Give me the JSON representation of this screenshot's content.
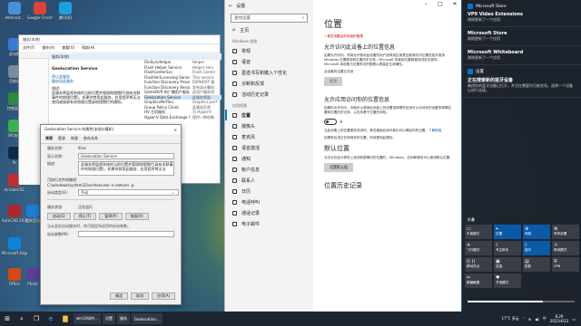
{
  "desktop": {
    "icons": [
      {
        "label": "Administ...",
        "color": "#4a90d9"
      },
      {
        "label": "Google Chrome",
        "color": "#db4437"
      },
      {
        "label": "腾讯QQ",
        "color": "#1aa1e2"
      },
      {
        "label": "此电脑",
        "color": "#3a7bd5"
      },
      {
        "label": "回收站",
        "color": "#7a8b99"
      },
      {
        "label": "控制面板",
        "color": "#2b8a3e"
      },
      {
        "label": "360安全",
        "color": "#37b24d"
      },
      {
        "label": "Ps",
        "color": "#0a2b4a"
      },
      {
        "label": "Acrobat DC",
        "color": "#c92a2a"
      },
      {
        "label": "AutoCAD 2020",
        "color": "#b02525"
      },
      {
        "label": "酷狗音乐",
        "color": "#1c7ed6"
      },
      {
        "label": "Microsoft Edge",
        "color": "#0b84d8"
      },
      {
        "label": "Office",
        "color": "#d9480f"
      },
      {
        "label": "Photo",
        "color": "#5c3d99"
      }
    ]
  },
  "services": {
    "title": "服务(本地)",
    "menu": [
      "文件(F)",
      "操作(A)",
      "查看(V)",
      "帮助(H)"
    ],
    "header": "服务(本地)",
    "name": "Geolocation Service",
    "desc": [
      "停止此服务",
      "重启动此服务",
      "描述:",
      "此服务将监视系统的当前位置并管理地理围栏(具有关联事件的地理位置)。如果你禁用此服务，应用程序将无法使用或接收有关地理位置或地理围栏的通知。"
    ],
    "rows": [
      {
        "n": "FileSyncHelper",
        "d": "Helper"
      },
      {
        "n": "Flash Helper Service",
        "d": "Helper serv"
      },
      {
        "n": "FlashCenterSvc",
        "d": "Flash Center"
      },
      {
        "n": "FlashVeriLicensing Service",
        "d": "This service"
      },
      {
        "n": "Function Discovery Provider Host",
        "d": "FDPHOST 服"
      },
      {
        "n": "Function Discovery Resource Publication",
        "d": "发布该计算机"
      },
      {
        "n": "GameDVR 和广播用户服务_5eb8",
        "d": "此用户服务用"
      },
      {
        "n": "Geolocation Service",
        "d": "此服务将监"
      },
      {
        "n": "GraphicsPerfSvc",
        "d": "Graphics perf"
      },
      {
        "n": "Group Policy Client",
        "d": "此服务负责"
      },
      {
        "n": "HV 主机服务",
        "d": "为 Hyper-V"
      },
      {
        "n": "Hyper-V Data Exchange Service",
        "d": "提供一种机制"
      }
    ]
  },
  "props": {
    "title": "Geolocation Service 的属性(本地计算机)",
    "tabs": [
      "常规",
      "登录",
      "恢复",
      "依存关系"
    ],
    "svcname_k": "服务名称:",
    "svcname_v": "lfsvc",
    "disp_k": "显示名称:",
    "disp_v": "Geolocation Service",
    "desc_k": "描述:",
    "desc_v": "此服务将监视系统的当前位置并管理地理围栏(具有关联事件的地理位置)。如果你禁用此服务，应用程序将无法",
    "path_k": "可执行文件的路径:",
    "path_v": "C:\\windows\\system32\\svchost.exe -k netsvcs -p",
    "start_k": "启动类型(E):",
    "start_v": "手动",
    "status_k": "服务状态:",
    "status_v": "正在运行",
    "btns": [
      "启动(S)",
      "停止(T)",
      "暂停(P)",
      "恢复(R)"
    ],
    "note": "当从此处启动服务时，你可指定所适用的启动参数。",
    "param_k": "启动参数(M):",
    "footer": [
      "确定",
      "取消",
      "应用(A)"
    ]
  },
  "settings": {
    "title": "设置",
    "search_placeholder": "查找设置",
    "home": "主页",
    "section": "Windows 权限",
    "nav1": [
      "常规",
      "语音",
      "墨迹书写和键入个性化",
      "诊断和反馈",
      "活动历史记录"
    ],
    "section2": "应用权限",
    "nav2": [
      "位置",
      "摄像头",
      "麦克风",
      "语音激活",
      "通知",
      "帐户信息",
      "联系人",
      "日历",
      "电话呼叫",
      "通话记录",
      "电子邮件"
    ],
    "heading": "位置",
    "notice": "• 某些设置由你的组织管理",
    "h_device": "允许访问此设备上的位置信息",
    "p_device": "如果允许访问，则将允许使用此设备的用户选择其应用是否能够访问位置信息并使用 Windows 位置服务和位置历史记录。Microsoft 将使用位置数据改进定位服务。Microsoft 将收集与位置有关的数据以提高定位准确性。",
    "status_device": "此设备的位置已关闭",
    "change": "更改",
    "h_apps": "允许应用访问你的位置信息",
    "p_apps": "如果你允许访问，你就可以使用此页面上的设置选择哪些应用可以访问你的设备的精确位置和位置历史记录，以支持基于位置的体验。",
    "toggle_label": "关",
    "p_default": "当此设备上的位置服务关闭时，某些桌面应用可能仍可以确定你的位置。",
    "learn": "了解原因",
    "p_default2": "如果有应用正在使用你的位置，你将看到此图标:",
    "h_default": "默认位置",
    "p_default3": "当无法在此计算机上检测到更确切的位置时，Windows、应用和服务可以使用默认位置。",
    "set_default": "设置默认值",
    "h_history": "位置历史记录"
  },
  "action": {
    "notifs": [
      {
        "app": "Microsoft Store",
        "title": "VP9 Video Extensions",
        "body": "刚刚更新了一个应用"
      },
      {
        "app": "",
        "title": "Microsoft Store",
        "body": "刚刚更新了一个应用"
      },
      {
        "app": "",
        "title": "Microsoft Whiteboard",
        "body": "刚刚更新了一个应用"
      },
      {
        "app": "设置",
        "title": "正在搜索新的蓝牙设备",
        "body": "确保你的蓝牙设备已打开，并且在需要时可被发现。选择一个设备以进行连接。"
      }
    ],
    "collapse": "折叠",
    "tiles": [
      {
        "l": "平板模式",
        "g": "▭",
        "on": false
      },
      {
        "l": "位置",
        "g": "⌖",
        "on": true
      },
      {
        "l": "网络",
        "g": "⊕",
        "on": true
      },
      {
        "l": "所有设置",
        "g": "⚙",
        "on": false
      },
      {
        "l": "飞行模式",
        "g": "✈",
        "on": false
      },
      {
        "l": "专注助手",
        "g": "☾",
        "on": false
      },
      {
        "l": "蓝牙",
        "g": "ᛒ",
        "on": true
      },
      {
        "l": "夜间模式",
        "g": "☼",
        "on": false
      },
      {
        "l": "移动热点",
        "g": "((·))",
        "on": false
      },
      {
        "l": "连接",
        "g": "▣",
        "on": false
      },
      {
        "l": "投影",
        "g": "▤",
        "on": false
      },
      {
        "l": "VPN",
        "g": "⛨",
        "on": false
      },
      {
        "l": "屏幕截图",
        "g": "✂",
        "on": false
      },
      {
        "l": "节电模式",
        "g": "♥",
        "on": false
      }
    ],
    "brightness": 70
  },
  "taskbar": {
    "apps": [
      "win10如何…",
      "设置",
      "服务",
      "Geolocation…"
    ],
    "temp": "17°C 多云",
    "ime": "中",
    "time": "8:29",
    "date": "2022/4/23"
  }
}
